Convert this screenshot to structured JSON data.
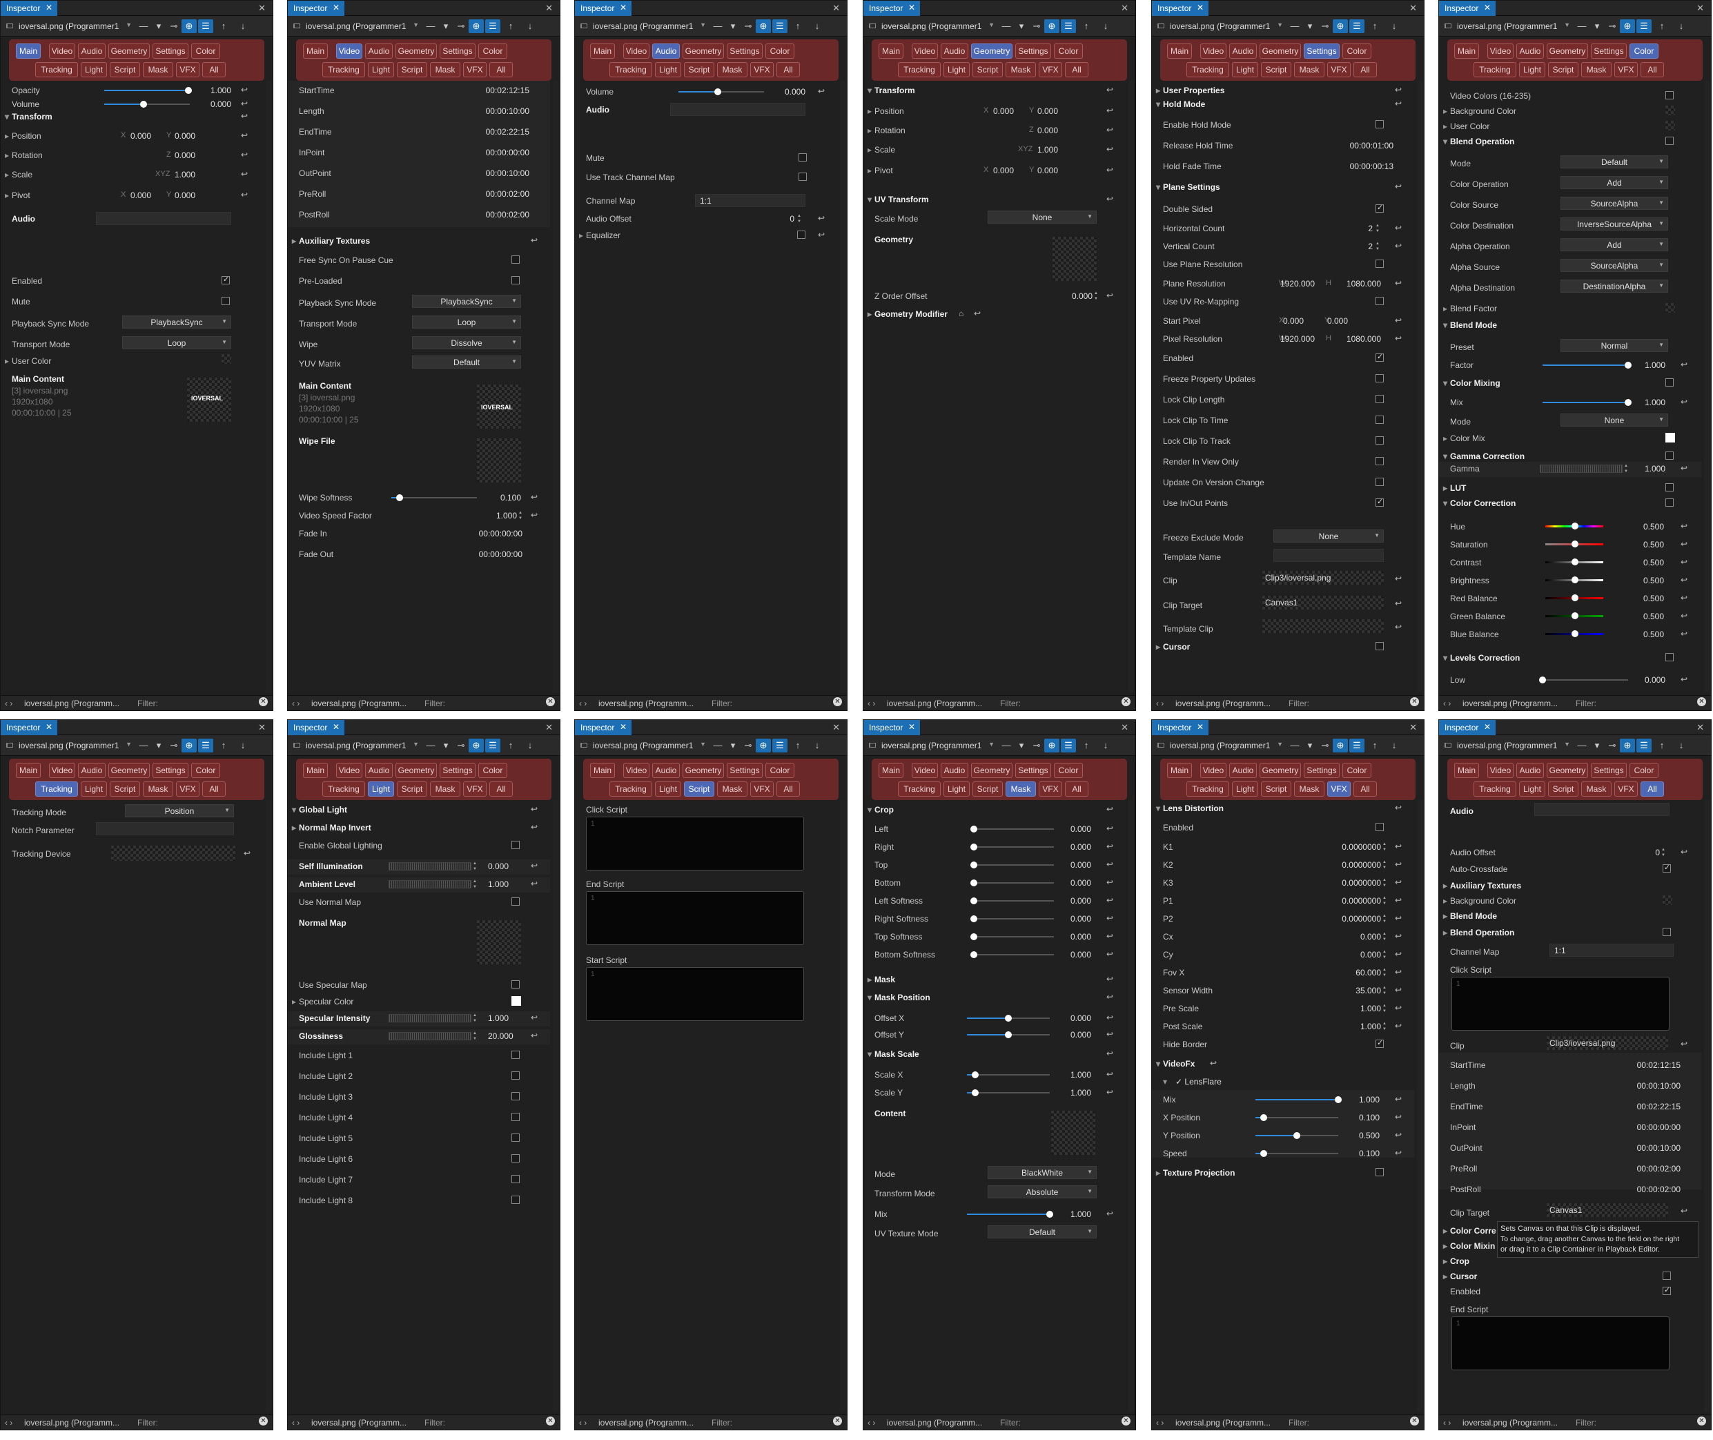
{
  "common": {
    "tab_label": "Inspector",
    "clip_combo": "ioversal.png (Programmer1",
    "status_name": "ioversal.png (Programm...",
    "filter_label": "Filter:",
    "tabs": [
      "Main",
      "Video",
      "Audio",
      "Geometry",
      "Settings",
      "Color",
      "Tracking",
      "Light",
      "Script",
      "Mask",
      "VFX",
      "All"
    ]
  },
  "main": {
    "opacity": {
      "label": "Opacity",
      "value": "1.000"
    },
    "volume": {
      "label": "Volume",
      "value": "0.000"
    },
    "transform": "Transform",
    "position": {
      "label": "Position",
      "x": "0.000",
      "y": "0.000"
    },
    "rotation": {
      "label": "Rotation",
      "z": "0.000"
    },
    "scale": {
      "label": "Scale",
      "xyz": "1.000"
    },
    "pivot": {
      "label": "Pivot",
      "x": "0.000",
      "y": "0.000"
    },
    "audio": "Audio",
    "enabled": "Enabled",
    "mute": "Mute",
    "playback_sync_mode": {
      "label": "Playback Sync Mode",
      "value": "PlaybackSync"
    },
    "transport_mode": {
      "label": "Transport Mode",
      "value": "Loop"
    },
    "user_color": "User Color",
    "main_content": {
      "label": "Main Content",
      "line1": "[3] ioversal.png",
      "line2": "1920x1080",
      "line3": "00:00:10:00 | 25",
      "logo": "IOVERSAL"
    }
  },
  "video": {
    "rows": [
      [
        "StartTime",
        "00:02:12:15"
      ],
      [
        "Length",
        "00:00:10:00"
      ],
      [
        "EndTime",
        "00:02:22:15"
      ],
      [
        "InPoint",
        "00:00:00:00"
      ],
      [
        "OutPoint",
        "00:00:10:00"
      ],
      [
        "PreRoll",
        "00:00:02:00"
      ],
      [
        "PostRoll",
        "00:00:02:00"
      ]
    ],
    "aux": "Auxiliary Textures",
    "free_sync": "Free Sync On Pause Cue",
    "preloaded": "Pre-Loaded",
    "playback_sync_mode": {
      "label": "Playback Sync Mode",
      "value": "PlaybackSync"
    },
    "transport_mode": {
      "label": "Transport Mode",
      "value": "Loop"
    },
    "wipe": {
      "label": "Wipe",
      "value": "Dissolve"
    },
    "yuv": {
      "label": "YUV Matrix",
      "value": "Default"
    },
    "main_content": {
      "label": "Main Content",
      "line1": "[3] ioversal.png",
      "line2": "1920x1080",
      "line3": "00:00:10:00 | 25",
      "logo": "IOVERSAL"
    },
    "wipe_file": "Wipe File",
    "wipe_softness": {
      "label": "Wipe Softness",
      "value": "0.100"
    },
    "video_speed": {
      "label": "Video Speed Factor",
      "value": "1.000"
    },
    "fade_in": {
      "label": "Fade In",
      "value": "00:00:00:00"
    },
    "fade_out": {
      "label": "Fade Out",
      "value": "00:00:00:00"
    }
  },
  "audio": {
    "volume": {
      "label": "Volume",
      "value": "0.000"
    },
    "audio": "Audio",
    "mute": "Mute",
    "use_track": "Use Track Channel Map",
    "channel_map": {
      "label": "Channel Map",
      "value": "1:1"
    },
    "audio_offset": {
      "label": "Audio Offset",
      "value": "0"
    },
    "equalizer": "Equalizer"
  },
  "geometry": {
    "transform": "Transform",
    "position": {
      "label": "Position",
      "x": "0.000",
      "y": "0.000"
    },
    "rotation": {
      "label": "Rotation",
      "z": "0.000"
    },
    "scale": {
      "label": "Scale",
      "xyz": "1.000"
    },
    "pivot": {
      "label": "Pivot",
      "x": "0.000",
      "y": "0.000"
    },
    "uv_transform": "UV Transform",
    "scale_mode": {
      "label": "Scale Mode",
      "value": "None"
    },
    "geometry": "Geometry",
    "z_order": {
      "label": "Z Order Offset",
      "value": "0.000"
    },
    "geometry_modifier": "Geometry Modifier"
  },
  "settings": {
    "user_properties": "User Properties",
    "hold_mode": "Hold Mode",
    "enable_hold": "Enable Hold Mode",
    "release_hold": {
      "label": "Release Hold Time",
      "value": "00:00:01:00"
    },
    "hold_fade": {
      "label": "Hold Fade Time",
      "value": "00:00:00:13"
    },
    "plane_settings": "Plane Settings",
    "double_sided": "Double Sided",
    "horizontal_count": {
      "label": "Horizontal Count",
      "value": "2"
    },
    "vertical_count": {
      "label": "Vertical Count",
      "value": "2"
    },
    "use_plane_res": "Use Plane Resolution",
    "plane_res": {
      "label": "Plane Resolution",
      "w": "1920.000",
      "h": "1080.000"
    },
    "use_uv": "Use UV Re-Mapping",
    "start_pixel": {
      "label": "Start Pixel",
      "x": "0.000",
      "y": "0.000"
    },
    "pixel_res": {
      "label": "Pixel Resolution",
      "w": "1920.000",
      "h": "1080.000"
    },
    "checks": [
      "Enabled",
      "Freeze Property Updates",
      "Lock Clip Length",
      "Lock Clip To Time",
      "Lock Clip To Track",
      "Render In View Only",
      "Update On Version Change",
      "Use In/Out Points"
    ],
    "freeze_exclude": {
      "label": "Freeze Exclude Mode",
      "value": "None"
    },
    "template_name": "Template Name",
    "clip": {
      "label": "Clip",
      "value": "Clip3/ioversal.png"
    },
    "clip_target": {
      "label": "Clip Target",
      "value": "Canvas1"
    },
    "template_clip": "Template Clip",
    "cursor": "Cursor"
  },
  "color": {
    "video_colors": "Video Colors (16-235)",
    "background_color": "Background Color",
    "user_color": "User Color",
    "blend_operation": "Blend Operation",
    "combos": [
      [
        "Mode",
        "Default"
      ],
      [
        "Color Operation",
        "Add"
      ],
      [
        "Color Source",
        "SourceAlpha"
      ],
      [
        "Color Destination",
        "InverseSourceAlpha"
      ],
      [
        "Alpha Operation",
        "Add"
      ],
      [
        "Alpha Source",
        "SourceAlpha"
      ],
      [
        "Alpha Destination",
        "DestinationAlpha"
      ]
    ],
    "blend_factor": "Blend Factor",
    "blend_mode": "Blend Mode",
    "preset": {
      "label": "Preset",
      "value": "Normal"
    },
    "factor": {
      "label": "Factor",
      "value": "1.000"
    },
    "color_mixing": "Color Mixing",
    "mix": {
      "label": "Mix",
      "value": "1.000"
    },
    "mode": {
      "label": "Mode",
      "value": "None"
    },
    "color_mix": "Color Mix",
    "gamma_correction": "Gamma Correction",
    "gamma": {
      "label": "Gamma",
      "value": "1.000"
    },
    "lut": "LUT",
    "color_correction": "Color Correction",
    "cc": [
      [
        "Hue",
        "0.500"
      ],
      [
        "Saturation",
        "0.500"
      ],
      [
        "Contrast",
        "0.500"
      ],
      [
        "Brightness",
        "0.500"
      ],
      [
        "Red Balance",
        "0.500"
      ],
      [
        "Green Balance",
        "0.500"
      ],
      [
        "Blue Balance",
        "0.500"
      ]
    ],
    "levels": "Levels Correction",
    "low": {
      "label": "Low",
      "value": "0.000"
    }
  },
  "tracking": {
    "tracking_mode": {
      "label": "Tracking Mode",
      "value": "Position"
    },
    "notch": "Notch Parameter",
    "device": "Tracking Device"
  },
  "light": {
    "global": "Global Light",
    "normal_invert": "Normal Map Invert",
    "enable_global": "Enable Global Lighting",
    "self_illum": {
      "label": "Self Illumination",
      "value": "0.000"
    },
    "ambient": {
      "label": "Ambient Level",
      "value": "1.000"
    },
    "use_normal": "Use Normal Map",
    "normal_map": "Normal Map",
    "use_specular": "Use Specular Map",
    "specular_color": "Specular Color",
    "specular_intensity": {
      "label": "Specular Intensity",
      "value": "1.000"
    },
    "glossiness": {
      "label": "Glossiness",
      "value": "20.000"
    },
    "lights": [
      "Include Light 1",
      "Include Light 2",
      "Include Light 3",
      "Include Light 4",
      "Include Light 5",
      "Include Light 6",
      "Include Light 7",
      "Include Light 8"
    ]
  },
  "script": {
    "click": "Click Script",
    "end": "End Script",
    "start": "Start Script",
    "line": "1"
  },
  "mask": {
    "crop": "Crop",
    "crop_rows": [
      [
        "Left",
        "0.000"
      ],
      [
        "Right",
        "0.000"
      ],
      [
        "Top",
        "0.000"
      ],
      [
        "Bottom",
        "0.000"
      ],
      [
        "Left Softness",
        "0.000"
      ],
      [
        "Right Softness",
        "0.000"
      ],
      [
        "Top Softness",
        "0.000"
      ],
      [
        "Bottom Softness",
        "0.000"
      ]
    ],
    "mask": "Mask",
    "mask_position": "Mask Position",
    "offset_x": {
      "label": "Offset X",
      "value": "0.000"
    },
    "offset_y": {
      "label": "Offset Y",
      "value": "0.000"
    },
    "mask_scale": "Mask Scale",
    "scale_x": {
      "label": "Scale X",
      "value": "1.000"
    },
    "scale_y": {
      "label": "Scale Y",
      "value": "1.000"
    },
    "content": "Content",
    "mode": {
      "label": "Mode",
      "value": "BlackWhite"
    },
    "transform_mode": {
      "label": "Transform Mode",
      "value": "Absolute"
    },
    "mix": {
      "label": "Mix",
      "value": "1.000"
    },
    "uv_texture": {
      "label": "UV Texture Mode",
      "value": "Default"
    }
  },
  "vfx": {
    "lens": "Lens Distortion",
    "enabled": "Enabled",
    "params": [
      [
        "K1",
        "0.0000000"
      ],
      [
        "K2",
        "0.0000000"
      ],
      [
        "K3",
        "0.0000000"
      ],
      [
        "P1",
        "0.0000000"
      ],
      [
        "P2",
        "0.0000000"
      ],
      [
        "Cx",
        "0.000"
      ],
      [
        "Cy",
        "0.000"
      ],
      [
        "Fov X",
        "60.000"
      ],
      [
        "Sensor Width",
        "35.000"
      ],
      [
        "Pre Scale",
        "1.000"
      ],
      [
        "Post Scale",
        "1.000"
      ]
    ],
    "hide_border": "Hide Border",
    "videofx": "VideoFx",
    "lensflare": "LensFlare",
    "fx": [
      [
        "Mix",
        "1.000"
      ],
      [
        "X Position",
        "0.100"
      ],
      [
        "Y Position",
        "0.500"
      ],
      [
        "Speed",
        "0.100"
      ]
    ],
    "texture_projection": "Texture Projection"
  },
  "all": {
    "audio": "Audio",
    "audio_offset": {
      "label": "Audio Offset",
      "value": "0"
    },
    "auto_crossfade": "Auto-Crossfade",
    "aux": "Auxiliary Textures",
    "background_color": "Background Color",
    "blend_mode": "Blend Mode",
    "blend_operation": "Blend Operation",
    "channel_map": {
      "label": "Channel Map",
      "value": "1:1"
    },
    "click_script": "Click Script",
    "clip": {
      "label": "Clip",
      "value": "Clip3/ioversal.png"
    },
    "rows": [
      [
        "StartTime",
        "00:02:12:15"
      ],
      [
        "Length",
        "00:00:10:00"
      ],
      [
        "EndTime",
        "00:02:22:15"
      ],
      [
        "InPoint",
        "00:00:00:00"
      ],
      [
        "OutPoint",
        "00:00:10:00"
      ],
      [
        "PreRoll",
        "00:00:02:00"
      ],
      [
        "PostRoll",
        "00:00:02:00"
      ]
    ],
    "clip_target": {
      "label": "Clip Target",
      "value": "Canvas1"
    },
    "color_corr": "Color Corre",
    "color_mix": "Color Mixin",
    "crop": "Crop",
    "cursor": "Cursor",
    "enabled": "Enabled",
    "end_script": "End Script",
    "tooltip": [
      "Sets Canvas on that this Clip is displayed.",
      "To change, drag another Canvas to the field on the right",
      "or drag it to a Clip Container in Playback Editor."
    ]
  }
}
